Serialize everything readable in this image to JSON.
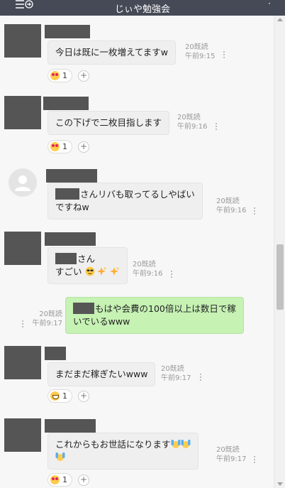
{
  "header": {
    "title": "じぃや勉強会"
  },
  "messages": [
    {
      "text": "今日は既に一枚増えてますw",
      "read": "20既読",
      "time": "午前9:15",
      "reaction_count": "1"
    },
    {
      "text": "この下げで二枚目指します",
      "read": "20既読",
      "time": "午前9:16",
      "reaction_count": "1"
    },
    {
      "text_1": "さんリバも取ってるしやばい",
      "text_2": "ですねw",
      "read": "20既読",
      "time": "午前9:16"
    },
    {
      "text_1": "さん",
      "text_2": "すごい",
      "read": "20既読",
      "time": "午前9:16"
    },
    {
      "text_1": "もはや会費の100倍以上は数日で稼",
      "text_2": "いでいるwww",
      "read": "20既読",
      "time": "午前9:17"
    },
    {
      "text": "まだまだ稼ぎたいwww",
      "read": "20既読",
      "time": "午前9:17",
      "reaction_count": "1"
    },
    {
      "text": "これからもお世話になります",
      "read": "20既読",
      "time": "午前9:17",
      "reaction_count": "1"
    }
  ],
  "icons": {
    "menu": "list-arrow-icon",
    "more": "kebab-icon",
    "default_avatar": "person-icon",
    "sunglasses": "smiling-face-with-sunglasses-emoji",
    "sparkles": "sparkles-emoji",
    "raised_hands": "raised-hands-emoji"
  },
  "colors": {
    "header": "#454a56",
    "my_bubble": "#c6f2b4",
    "other_bubble": "#efefef",
    "redaction": "#555555"
  }
}
